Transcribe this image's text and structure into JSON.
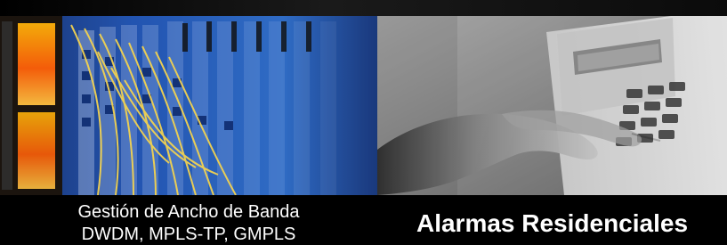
{
  "captions": {
    "left": {
      "line1": "Gestión de Ancho de Banda",
      "line2": "DWDM, MPLS-TP, GMPLS"
    },
    "right": {
      "title": "Alarmas Residenciales"
    }
  },
  "photos": {
    "left": {
      "icon": "fiber-optic-patch-panel-photo"
    },
    "right": {
      "icon": "alarm-keypad-hand-photo"
    }
  },
  "colors": {
    "background": "#000000",
    "left_accent_blue": "#0e2d6e",
    "left_fiber_yellow": "#f2d04a",
    "left_glow_orange": "#ff7a00",
    "right_gray": "#8a8a8a"
  }
}
